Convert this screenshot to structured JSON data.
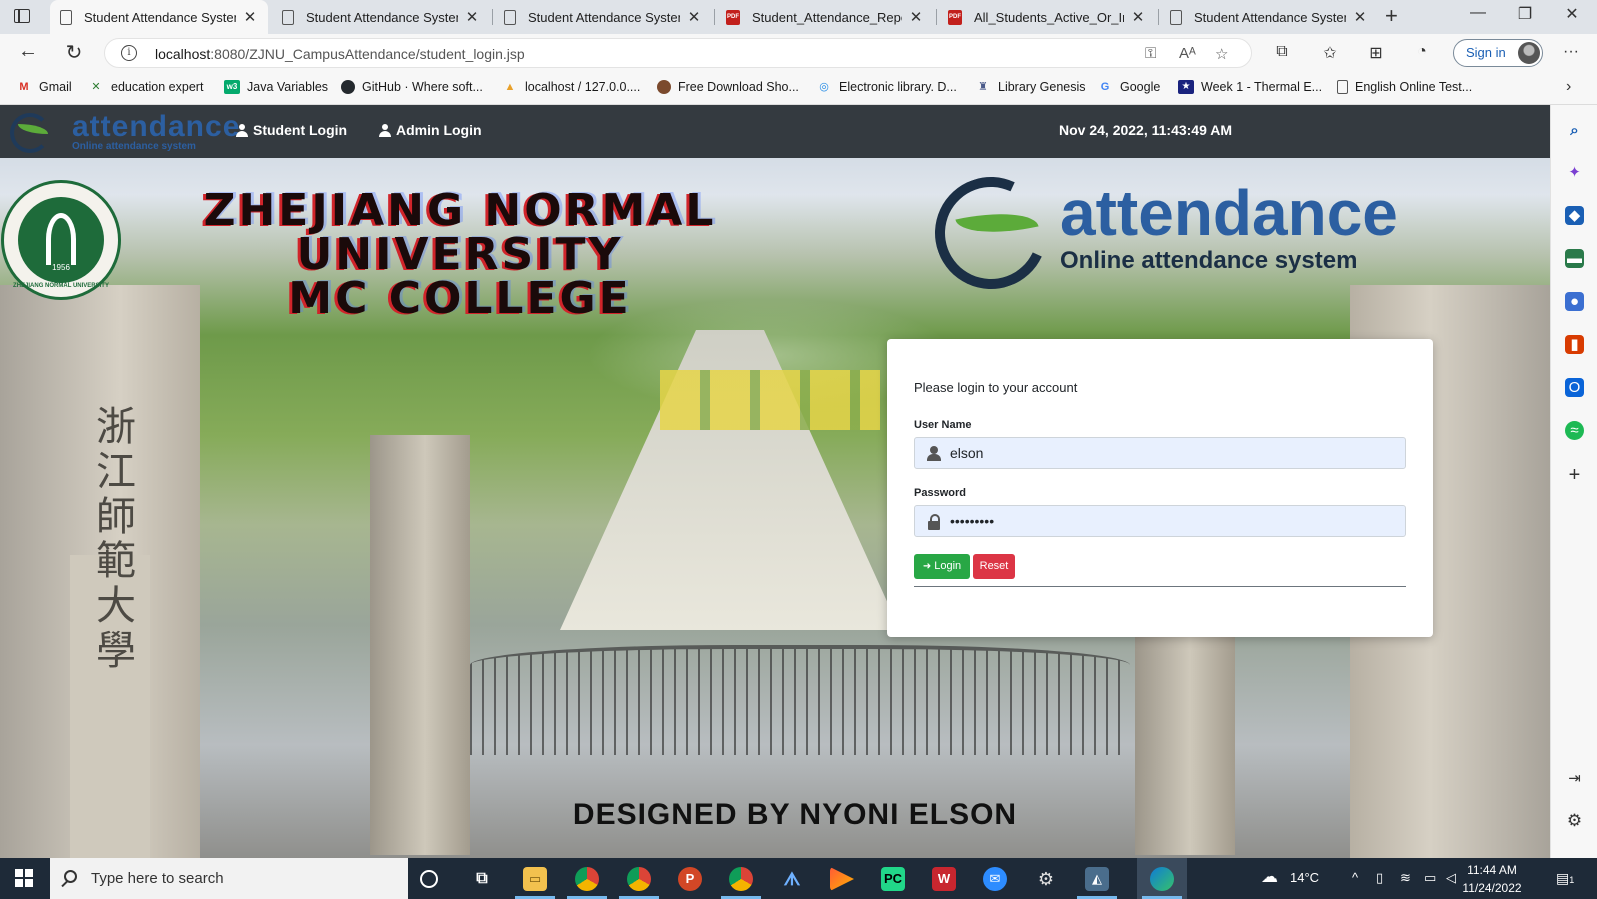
{
  "browser": {
    "tabs": [
      {
        "title": "Student Attendance System",
        "icon": "page-icon",
        "active": true
      },
      {
        "title": "Student Attendance System",
        "icon": "page-icon",
        "active": false
      },
      {
        "title": "Student Attendance System",
        "icon": "page-icon",
        "active": false
      },
      {
        "title": "Student_Attendance_Report",
        "icon": "pdf-icon",
        "active": false
      },
      {
        "title": "All_Students_Active_Or_Inac",
        "icon": "pdf-icon",
        "active": false
      },
      {
        "title": "Student Attendance System",
        "icon": "page-icon",
        "active": false
      }
    ],
    "url_host": "localhost",
    "url_path": ":8080/ZJNU_CampusAttendance/student_login.jsp",
    "sign_in_label": "Sign in",
    "bookmarks": [
      {
        "label": "Gmail",
        "icon": "gmail-icon",
        "color": "#d93025",
        "glyph": "M"
      },
      {
        "label": "education expert",
        "icon": "education-expert-icon",
        "color": "#2e7d32",
        "glyph": "✕"
      },
      {
        "label": "Java Variables",
        "icon": "w3-icon",
        "color": "#04aa6d",
        "glyph": "w3"
      },
      {
        "label": "GitHub · Where soft...",
        "icon": "github-icon",
        "color": "#24292e",
        "glyph": "●"
      },
      {
        "label": "localhost / 127.0.0....",
        "icon": "phpmyadmin-icon",
        "color": "#e8a02a",
        "glyph": "▲"
      },
      {
        "label": "Free Download Sho...",
        "icon": "download-site-icon",
        "color": "#7b4a2d",
        "glyph": "●"
      },
      {
        "label": "Electronic library. D...",
        "icon": "globe-icon",
        "color": "#1e88e5",
        "glyph": "◎"
      },
      {
        "label": "Library Genesis",
        "icon": "library-genesis-icon",
        "color": "#4a5a8a",
        "glyph": "♜"
      },
      {
        "label": "Google",
        "icon": "google-icon",
        "color": "#4285f4",
        "glyph": "G"
      },
      {
        "label": "Week 1 - Thermal E...",
        "icon": "course-site-icon",
        "color": "#1a237e",
        "glyph": "★"
      },
      {
        "label": "English Online Test...",
        "icon": "page-icon",
        "color": "#ffffff",
        "glyph": ""
      }
    ]
  },
  "site": {
    "brand_word": "attendance",
    "brand_sub": "Online attendance system",
    "nav": {
      "student_login": "Student Login",
      "admin_login": "Admin Login"
    },
    "datetime": "Nov 24, 2022, 11:43:49 AM",
    "university_line1": "ZHEJIANG NORMAL UNIVERSITY",
    "university_line2": "MC COLLEGE",
    "seal_year": "1956",
    "seal_text": "ZHEJIANG NORMAL UNIVERSITY",
    "gate_characters": [
      "浙",
      "江",
      "師",
      "範",
      "大",
      "學"
    ],
    "logo_word": "attendance",
    "logo_sub": "Online attendance system",
    "credit": "DESIGNED BY NYONI ELSON"
  },
  "login": {
    "intro": "Please login to your account",
    "username_label": "User Name",
    "username_value": "elson",
    "password_label": "Password",
    "password_value": "•••••••••",
    "login_button": "Login",
    "reset_button": "Reset"
  },
  "taskbar": {
    "search_placeholder": "Type here to search",
    "temperature": "14°C",
    "time": "11:44 AM",
    "date": "11/24/2022",
    "notification_count": "1"
  },
  "colors": {
    "site_nav": "#343a40",
    "login_button": "#28a745",
    "reset_button": "#dc3545",
    "brand_blue": "#2c5fa1",
    "field_bg": "#e8f0fe"
  }
}
